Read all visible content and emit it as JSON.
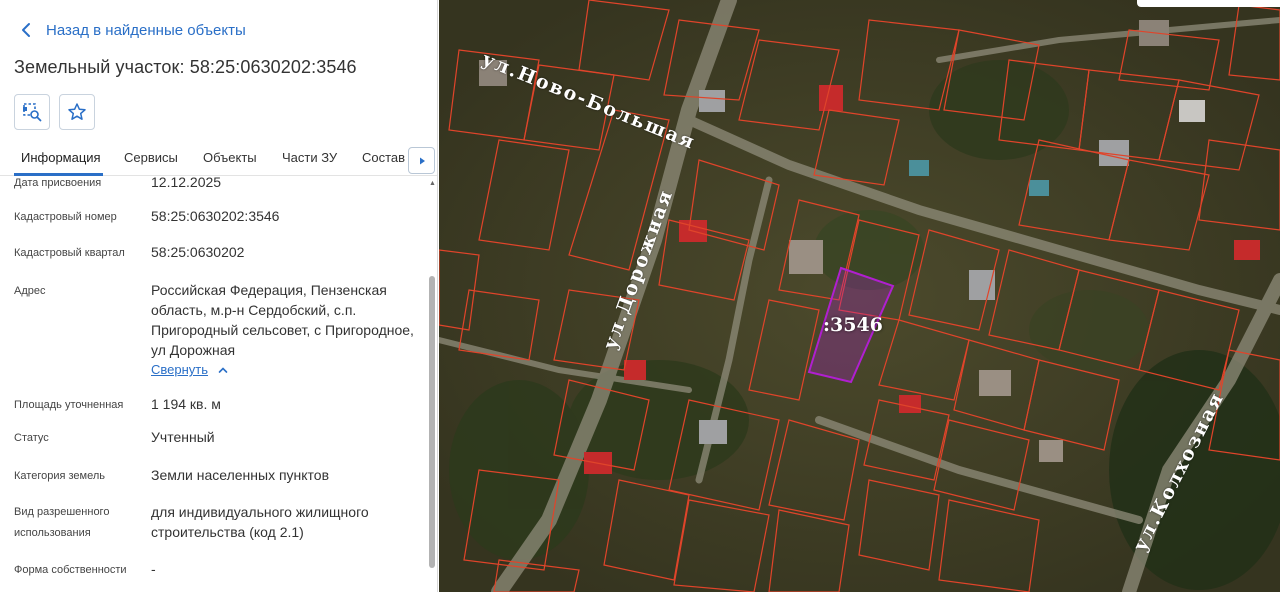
{
  "panel": {
    "back_label": "Назад в найденные объекты",
    "title": "Земельный участок: 58:25:0630202:3546",
    "tabs": [
      "Информация",
      "Сервисы",
      "Объекты",
      "Части ЗУ",
      "Состав"
    ],
    "active_tab": "Информация",
    "fields": [
      {
        "label": "Дата присвоения",
        "value": "12.12.2025"
      },
      {
        "label": "Кадастровый номер",
        "value": "58:25:0630202:3546"
      },
      {
        "label": "Кадастровый квартал",
        "value": "58:25:0630202"
      },
      {
        "label": "Адрес",
        "value": "Российская Федерация, Пензенская область, м.р-н Сердобский, с.п. Пригородный сельсовет, с Пригородное, ул Дорожная"
      },
      {
        "label": "Площадь уточненная",
        "value": "1 194 кв. м"
      },
      {
        "label": "Статус",
        "value": "Учтенный"
      },
      {
        "label": "Категория земель",
        "value": "Земли населенных пунктов"
      },
      {
        "label_line1": "Вид разрешенного",
        "label_line2": "использования",
        "value": "для индивидуального жилищного строительства (код 2.1)"
      },
      {
        "label": "Форма собственности",
        "value": "-"
      }
    ],
    "collapse_label": "Свернуть"
  },
  "map": {
    "streets": {
      "novo_bolshaya": "ул.Ново-Большая",
      "dorozhnaya": "ул.Дорожная",
      "kolkhoznaya": "ул.Колхозная"
    },
    "parcel_label": ":3546",
    "parcel_color": "#b01fd0",
    "boundary_color": "#e0442a"
  },
  "colors": {
    "accent": "#2a6fc7"
  }
}
